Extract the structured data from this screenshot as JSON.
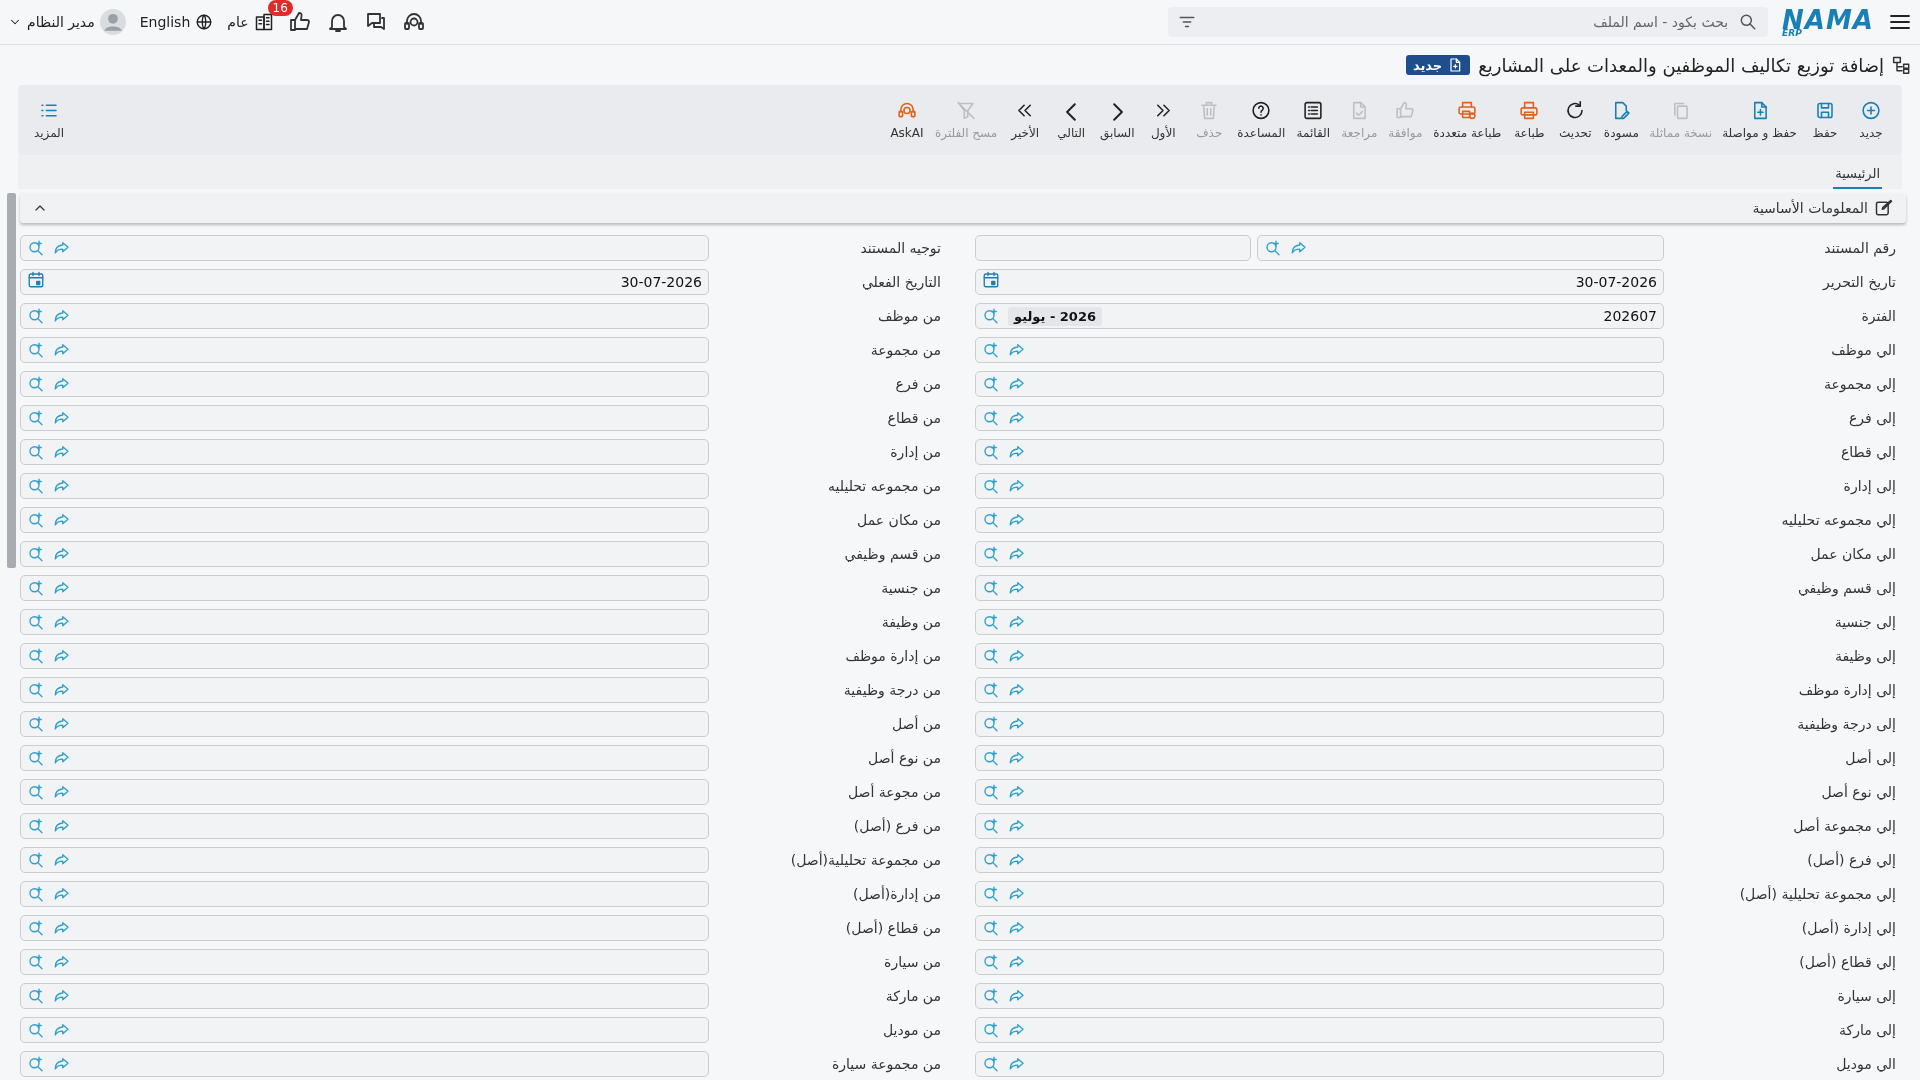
{
  "topbar": {
    "logo": {
      "text": "NAMA",
      "sub": "ERP"
    },
    "search": {
      "placeholder": "بحث بكود - اسم الملف"
    },
    "language": "English",
    "branch": "عام",
    "notifications_badge": "16",
    "user": "مدير النظام"
  },
  "page": {
    "title": "إضافة توزيع تكاليف الموظفين والمعدات على المشاريع",
    "status_badge": "جديد"
  },
  "toolbar": {
    "actions": [
      {
        "label": "جديد",
        "disabled": false
      },
      {
        "label": "حفظ",
        "disabled": false
      },
      {
        "label": "حفظ و مواصلة",
        "disabled": false
      },
      {
        "label": "نسخة مماثلة",
        "disabled": true
      },
      {
        "label": "مسودة",
        "disabled": false
      },
      {
        "label": "تحديث",
        "disabled": false
      },
      {
        "label": "طباعة",
        "disabled": false
      },
      {
        "label": "طباعة متعددة",
        "disabled": false
      },
      {
        "label": "موافقة",
        "disabled": true
      },
      {
        "label": "مراجعة",
        "disabled": true
      },
      {
        "label": "القائمة",
        "disabled": false
      },
      {
        "label": "المساعدة",
        "disabled": false
      },
      {
        "label": "حذف",
        "disabled": true
      },
      {
        "label": "الأول",
        "disabled": false
      },
      {
        "label": "السابق",
        "disabled": false
      },
      {
        "label": "التالي",
        "disabled": false
      },
      {
        "label": "الأخير",
        "disabled": false
      },
      {
        "label": "مسح الفلترة",
        "disabled": true
      },
      {
        "label": "AskAI",
        "disabled": false
      }
    ],
    "more": "المزيد"
  },
  "tabs": [
    {
      "label": "الرئيسية",
      "selected": true
    }
  ],
  "section": {
    "title": "المعلومات الأساسية",
    "expanded": true,
    "fields": [
      {
        "label": "رقم المستند",
        "kind": "doc-number"
      },
      {
        "label": "توجيه المستند",
        "kind": "lookup"
      },
      {
        "label": "تاريخ التحرير",
        "kind": "date",
        "value": "30-07-2026"
      },
      {
        "label": "التاريخ الفعلي",
        "kind": "date",
        "value": "30-07-2026"
      },
      {
        "label": "الفترة",
        "kind": "period",
        "value": "202607",
        "chip": "2026 - يوليو"
      },
      {
        "label": "من موظف",
        "kind": "lookup"
      },
      {
        "label": "الي موظف",
        "kind": "lookup"
      },
      {
        "label": "من مجموعة",
        "kind": "lookup"
      },
      {
        "label": "إلي مجموعة",
        "kind": "lookup"
      },
      {
        "label": "من فرع",
        "kind": "lookup"
      },
      {
        "label": "إلى فرع",
        "kind": "lookup"
      },
      {
        "label": "من قطاع",
        "kind": "lookup"
      },
      {
        "label": "إلي قطاع",
        "kind": "lookup"
      },
      {
        "label": "من إدارة",
        "kind": "lookup"
      },
      {
        "label": "إلى إدارة",
        "kind": "lookup"
      },
      {
        "label": "من مجموعه تحليليه",
        "kind": "lookup"
      },
      {
        "label": "إلي مجموعه تحليليه",
        "kind": "lookup"
      },
      {
        "label": "من مكان عمل",
        "kind": "lookup"
      },
      {
        "label": "الي مكان عمل",
        "kind": "lookup"
      },
      {
        "label": "من قسم وظيفي",
        "kind": "lookup"
      },
      {
        "label": "إلى قسم وظيفي",
        "kind": "lookup"
      },
      {
        "label": "من جنسية",
        "kind": "lookup"
      },
      {
        "label": "إلى جنسية",
        "kind": "lookup"
      },
      {
        "label": "من وظيفة",
        "kind": "lookup"
      },
      {
        "label": "إلى وظيفة",
        "kind": "lookup"
      },
      {
        "label": "من إدارة موظف",
        "kind": "lookup"
      },
      {
        "label": "إلى إدارة موظف",
        "kind": "lookup"
      },
      {
        "label": "من درجة وظيفية",
        "kind": "lookup"
      },
      {
        "label": "إلى درجة وظيفية",
        "kind": "lookup"
      },
      {
        "label": "من أصل",
        "kind": "lookup"
      },
      {
        "label": "إلى أصل",
        "kind": "lookup"
      },
      {
        "label": "من نوع أصل",
        "kind": "lookup"
      },
      {
        "label": "إلي نوع أصل",
        "kind": "lookup"
      },
      {
        "label": "من مجوعة أصل",
        "kind": "lookup"
      },
      {
        "label": "إلي مجموعة أصل",
        "kind": "lookup"
      },
      {
        "label": "من فرع (أصل)",
        "kind": "lookup"
      },
      {
        "label": "إلي فرع (أصل)",
        "kind": "lookup"
      },
      {
        "label": "من مجموعة تحليلية(أصل)",
        "kind": "lookup"
      },
      {
        "label": "إلي مجموعة تحليلية (أصل)",
        "kind": "lookup"
      },
      {
        "label": "من إدارة(أصل)",
        "kind": "lookup"
      },
      {
        "label": "إلي إدارة (أصل)",
        "kind": "lookup"
      },
      {
        "label": "من قطاع (أصل)",
        "kind": "lookup"
      },
      {
        "label": "إلي قطاع (أصل)",
        "kind": "lookup"
      },
      {
        "label": "من سيارة",
        "kind": "lookup"
      },
      {
        "label": "إلى سيارة",
        "kind": "lookup"
      },
      {
        "label": "من ماركة",
        "kind": "lookup"
      },
      {
        "label": "إلى ماركة",
        "kind": "lookup"
      },
      {
        "label": "من موديل",
        "kind": "lookup"
      },
      {
        "label": "الي موديل",
        "kind": "lookup"
      },
      {
        "label": "من مجموعة سيارة",
        "kind": "lookup"
      }
    ]
  }
}
